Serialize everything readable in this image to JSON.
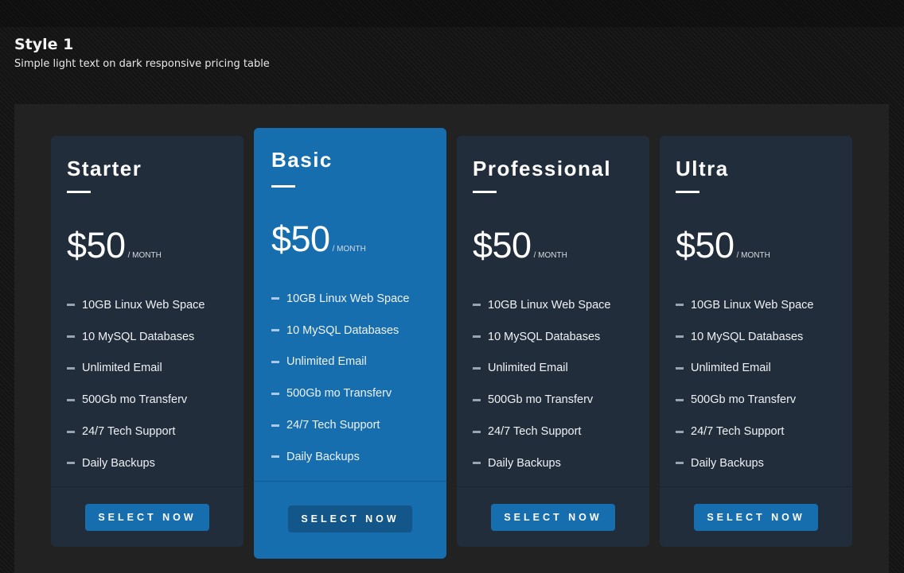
{
  "header": {
    "title": "Style 1",
    "subtitle": "Simple light text on dark responsive pricing table"
  },
  "colors": {
    "card_background": "#222d3b",
    "featured_background": "#176eae",
    "button_background": "#176eae",
    "featured_button_background": "#12568a",
    "panel_background": "#222222"
  },
  "plans": [
    {
      "name": "Starter",
      "price": "$50",
      "period": "/ MONTH",
      "featured": false,
      "features": [
        "10GB Linux Web Space",
        "10 MySQL Databases",
        "Unlimited Email",
        "500Gb mo Transferv",
        "24/7 Tech Support",
        "Daily Backups"
      ],
      "button_label": "SELECT NOW"
    },
    {
      "name": "Basic",
      "price": "$50",
      "period": "/ MONTH",
      "featured": true,
      "features": [
        "10GB Linux Web Space",
        "10 MySQL Databases",
        "Unlimited Email",
        "500Gb mo Transferv",
        "24/7 Tech Support",
        "Daily Backups"
      ],
      "button_label": "SELECT NOW"
    },
    {
      "name": "Professional",
      "price": "$50",
      "period": "/ MONTH",
      "featured": false,
      "features": [
        "10GB Linux Web Space",
        "10 MySQL Databases",
        "Unlimited Email",
        "500Gb mo Transferv",
        "24/7 Tech Support",
        "Daily Backups"
      ],
      "button_label": "SELECT NOW"
    },
    {
      "name": "Ultra",
      "price": "$50",
      "period": "/ MONTH",
      "featured": false,
      "features": [
        "10GB Linux Web Space",
        "10 MySQL Databases",
        "Unlimited Email",
        "500Gb mo Transferv",
        "24/7 Tech Support",
        "Daily Backups"
      ],
      "button_label": "SELECT NOW"
    }
  ]
}
